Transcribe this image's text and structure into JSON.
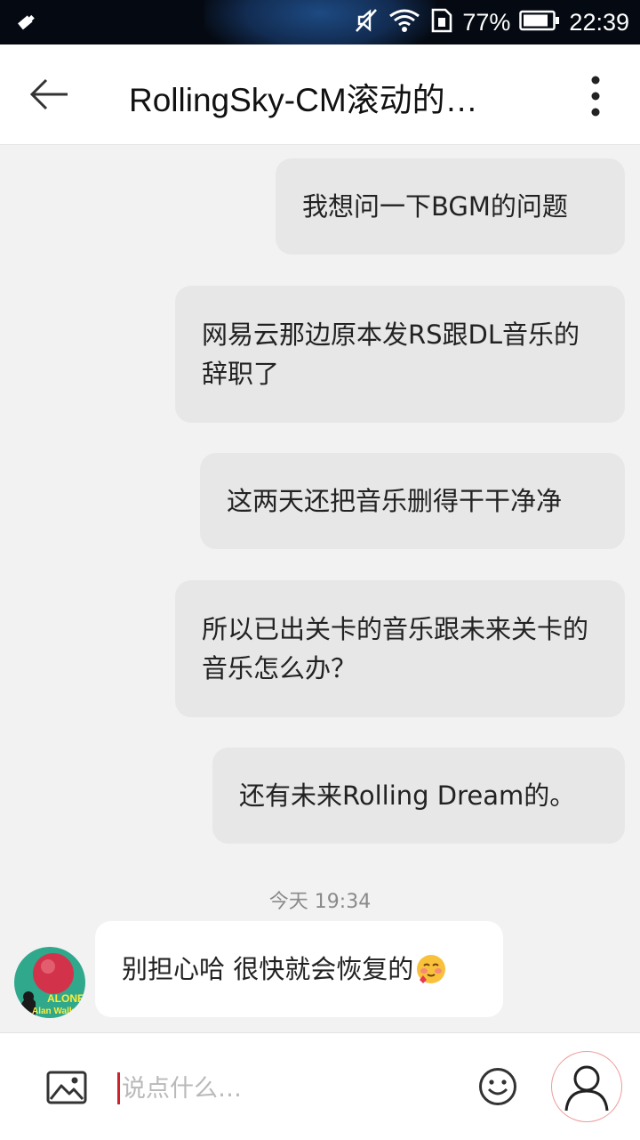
{
  "status_bar": {
    "battery": "77%",
    "time": "22:39"
  },
  "header": {
    "title": "RollingSky-CM滚动的…"
  },
  "messages": [
    {
      "text": "我想问一下BGM的问题"
    },
    {
      "text": "网易云那边原本发RS跟DL音乐的辞职了"
    },
    {
      "text": "这两天还把音乐删得干干净净"
    },
    {
      "text": "所以已出关卡的音乐跟未来关卡的音乐怎么办？"
    },
    {
      "text": "还有未来Rolling Dream的。"
    }
  ],
  "timestamp": "今天 19:34",
  "reply": {
    "text": "别担心哈 很快就会恢复的",
    "avatar_text": {
      "line1": "ALONE",
      "line2": "Alan Walker"
    }
  },
  "input": {
    "placeholder": "说点什么…"
  },
  "colors": {
    "caret": "#d0202a",
    "outgoing_bubble": "#e7e7e7",
    "incoming_bubble": "#ffffff"
  }
}
